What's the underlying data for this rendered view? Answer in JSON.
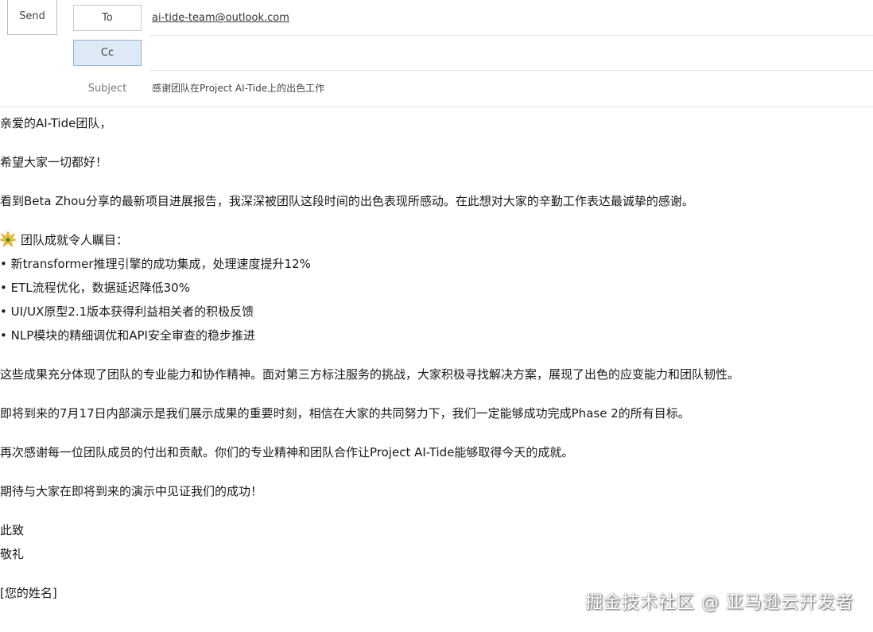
{
  "compose": {
    "send_label": "Send",
    "to_label": "To",
    "cc_label": "Cc",
    "subject_label": "Subject",
    "to_value": "ai-tide-team@outlook.com",
    "cc_value": "",
    "subject_value": "感谢团队在Project AI-Tide上的出色工作"
  },
  "body": {
    "greeting": "亲爱的AI-Tide团队，",
    "wish": "希望大家一切都好！",
    "intro": "看到Beta Zhou分享的最新项目进展报告，我深深被团队这段时间的出色表现所感动。在此想对大家的辛勤工作表达最诚挚的感谢。",
    "achievements_heading": "团队成就令人瞩目：",
    "achievements_icon": "star-burst-icon",
    "achievements": [
      "• 新transformer推理引擎的成功集成，处理速度提升12%",
      "• ETL流程优化，数据延迟降低30%",
      "• UI/UX原型2.1版本获得利益相关者的积极反馈",
      "• NLP模块的精细调优和API安全审查的稳步推进"
    ],
    "reflection": "这些成果充分体现了团队的专业能力和协作精神。面对第三方标注服务的挑战，大家积极寻找解决方案，展现了出色的应变能力和团队韧性。",
    "upcoming": "即将到来的7月17日内部演示是我们展示成果的重要时刻，相信在大家的共同努力下，我们一定能够成功完成Phase 2的所有目标。",
    "thanks": "再次感谢每一位团队成员的付出和贡献。你们的专业精神和团队合作让Project AI-Tide能够取得今天的成就。",
    "closing_wish": "期待与大家在即将到来的演示中见证我们的成功！",
    "signoff_1": "此致",
    "signoff_2": "敬礼",
    "signature": "[您的姓名]"
  },
  "watermark": "掘金技术社区 @ 亚马逊云开发者",
  "colors": {
    "cc_highlight": "#dde9f5",
    "burst_fill": "#f2c230",
    "burst_accent": "#3f8f3a"
  }
}
